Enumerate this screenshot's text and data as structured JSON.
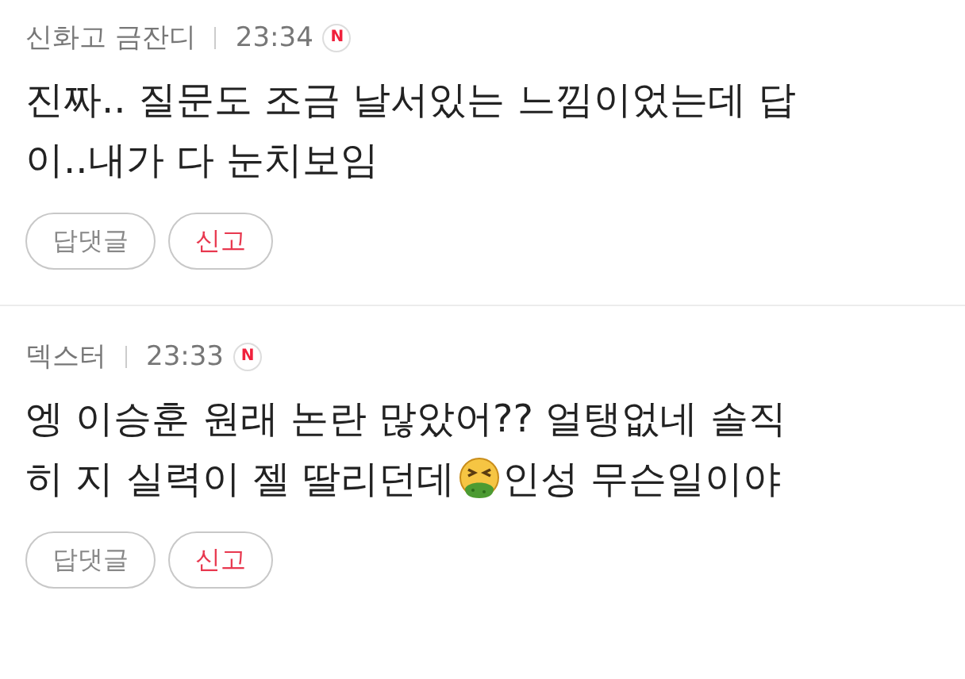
{
  "comments": [
    {
      "author": "신화고 금잔디",
      "time": "23:34",
      "badge": "N",
      "lines": [
        [
          {
            "kind": "text",
            "text": "진짜.. 질문도 조금 날서있는 느낌이었는데 답"
          }
        ],
        [
          {
            "kind": "text",
            "text": "이..내가 다 눈치보임"
          }
        ]
      ],
      "reply_button": "답댓글",
      "report_button": "신고"
    },
    {
      "author": "덱스터",
      "time": "23:33",
      "badge": "N",
      "lines": [
        [
          {
            "kind": "text",
            "text": "엥 이승훈 원래 논란 많았어?? 얼탱없네 솔직"
          }
        ],
        [
          {
            "kind": "text",
            "text": "히 지 실력이 젤 딸리던데"
          },
          {
            "kind": "emoji"
          },
          {
            "kind": "text",
            "text": "인성 무슨일이야"
          }
        ]
      ],
      "reply_button": "답댓글",
      "report_button": "신고"
    }
  ]
}
